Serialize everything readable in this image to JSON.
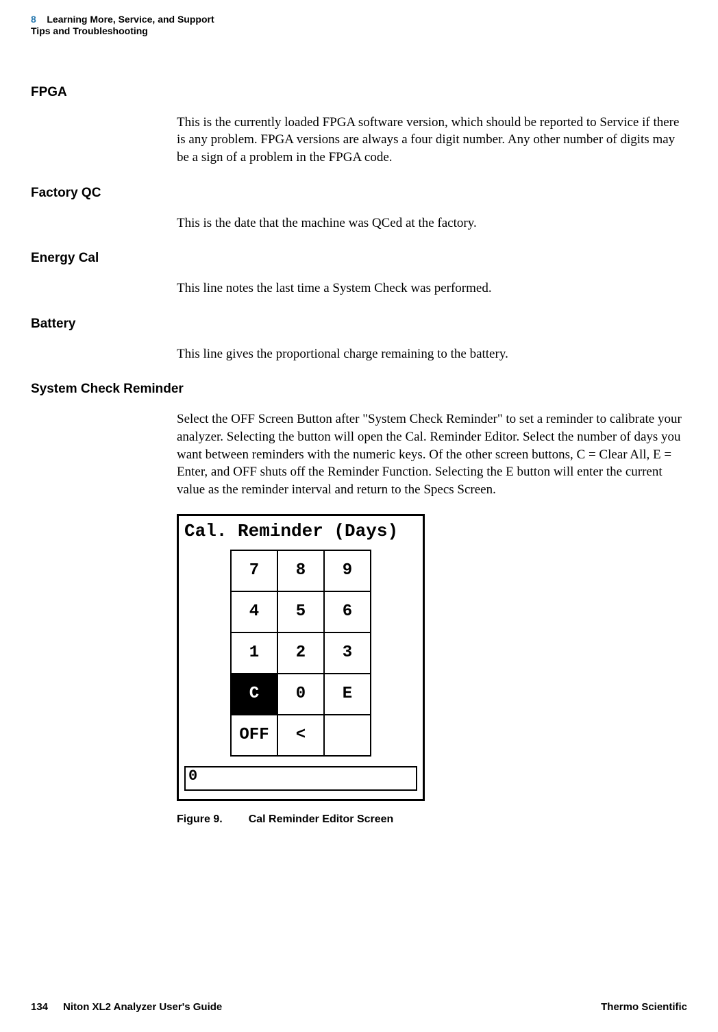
{
  "header": {
    "chapter_number": "8",
    "chapter_title": "Learning More, Service, and Support",
    "subtitle": "Tips and Troubleshooting"
  },
  "sections": {
    "fpga": {
      "heading": "FPGA",
      "body": "This is the currently loaded FPGA software version, which should be reported to Service if there is any problem. FPGA versions are always a four digit number. Any other number of digits may be a sign of a problem in the FPGA code."
    },
    "factory_qc": {
      "heading": "Factory QC",
      "body": "This is the date that the machine was QCed at the factory."
    },
    "energy_cal": {
      "heading": "Energy Cal",
      "body": "This line notes the last time a System Check was performed."
    },
    "battery": {
      "heading": "Battery",
      "body": "This line gives the proportional charge remaining to the battery."
    },
    "system_check": {
      "heading": "System Check Reminder",
      "body": "Select the OFF Screen Button after \"System Check Reminder\" to set a reminder to calibrate your analyzer. Selecting the button will open the Cal. Reminder Editor. Select the number of days you want between reminders with the numeric keys. Of the other screen buttons, C = Clear All, E = Enter, and OFF shuts off the Reminder Function. Selecting the E button will enter the current value as the reminder interval and return to the Specs Screen."
    }
  },
  "figure": {
    "title": "Cal. Reminder (Days)",
    "keys": {
      "r0": [
        "7",
        "8",
        "9"
      ],
      "r1": [
        "4",
        "5",
        "6"
      ],
      "r2": [
        "1",
        "2",
        "3"
      ],
      "r3": [
        "C",
        "0",
        "E"
      ],
      "r4": [
        "OFF",
        "<",
        ""
      ]
    },
    "value": "0",
    "caption_label": "Figure 9.",
    "caption_text": "Cal Reminder Editor Screen"
  },
  "footer": {
    "page_number": "134",
    "guide": "Niton XL2 Analyzer User's Guide",
    "brand": "Thermo Scientific"
  }
}
